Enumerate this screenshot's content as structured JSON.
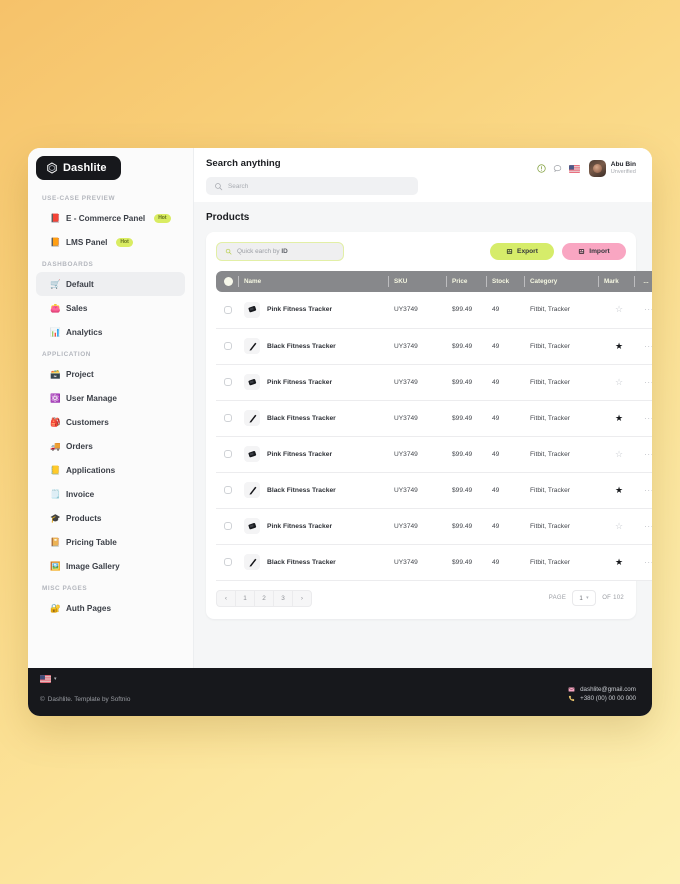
{
  "theme": {
    "bg_gradient_from": "#f6c26a",
    "bg_gradient_to": "#fdf0b4",
    "accent_lime": "#d6ec6a",
    "accent_pink": "#f9a6c2",
    "dark": "#17181c",
    "header_gray": "#87888b"
  },
  "sidebar": {
    "logo": {
      "text": "Dashlite",
      "icon": "hexagon-icon"
    },
    "toggle_icon": "panel-toggle-icon",
    "sections": [
      {
        "label": "USE-CASE PREVIEW",
        "items": [
          {
            "label": "E - Commerce Panel",
            "emoji": "📕",
            "badge": "Hot",
            "active": false
          },
          {
            "label": "LMS Panel",
            "emoji": "📙",
            "badge": "Hot",
            "active": false
          }
        ]
      },
      {
        "label": "DASHBOARDS",
        "items": [
          {
            "label": "Default",
            "emoji": "🛒",
            "badge": "",
            "active": true
          },
          {
            "label": "Sales",
            "emoji": "👛",
            "badge": "",
            "active": false
          },
          {
            "label": "Analytics",
            "emoji": "📊",
            "badge": "",
            "active": false
          }
        ]
      },
      {
        "label": "APPLICATION",
        "items": [
          {
            "label": "Project",
            "emoji": "🗃️",
            "badge": "",
            "active": false
          },
          {
            "label": "User Manage",
            "emoji": "⚛️",
            "badge": "",
            "active": false
          },
          {
            "label": "Customers",
            "emoji": "🎒",
            "badge": "",
            "active": false
          },
          {
            "label": "Orders",
            "emoji": "🚚",
            "badge": "",
            "active": false
          },
          {
            "label": "Applications",
            "emoji": "📒",
            "badge": "",
            "active": false
          },
          {
            "label": "Invoice",
            "emoji": "🗒️",
            "badge": "",
            "active": false
          },
          {
            "label": "Products",
            "emoji": "🎓",
            "badge": "",
            "active": false
          },
          {
            "label": "Pricing Table",
            "emoji": "📔",
            "badge": "",
            "active": false
          },
          {
            "label": "Image Gallery",
            "emoji": "🖼️",
            "badge": "",
            "active": false
          }
        ]
      },
      {
        "label": "MISC PAGES",
        "items": [
          {
            "label": "Auth Pages",
            "emoji": "🔐",
            "badge": "",
            "active": false
          }
        ]
      }
    ]
  },
  "topbar": {
    "search_title": "Search anything",
    "search_placeholder": "Search",
    "search_value": "",
    "icons": [
      "info-icon",
      "chat-icon",
      "flag-icon"
    ],
    "user": {
      "name": "Abu Bin",
      "status": "Unverified",
      "avatar": "avatar"
    }
  },
  "page": {
    "title": "Products"
  },
  "toolbar": {
    "quick_search_placeholder_prefix": "Quick earch by ",
    "quick_search_placeholder_bold": "ID",
    "quick_search_value": "",
    "export_label": "Export",
    "import_label": "Import"
  },
  "table": {
    "columns": [
      "Name",
      "SKU",
      "Price",
      "Stock",
      "Category",
      "Mark",
      "..."
    ],
    "rows": [
      {
        "name": "Pink Fitness Tracker",
        "sku": "UY3749",
        "price": "$99.49",
        "stock": "49",
        "category": "Fitbit, Tracker",
        "marked": false,
        "thumb": "pink",
        "checked": false
      },
      {
        "name": "Black Fitness Tracker",
        "sku": "UY3749",
        "price": "$99.49",
        "stock": "49",
        "category": "Fitbit, Tracker",
        "marked": true,
        "thumb": "black",
        "checked": false
      },
      {
        "name": "Pink Fitness Tracker",
        "sku": "UY3749",
        "price": "$99.49",
        "stock": "49",
        "category": "Fitbit, Tracker",
        "marked": false,
        "thumb": "pink",
        "checked": false
      },
      {
        "name": "Black Fitness Tracker",
        "sku": "UY3749",
        "price": "$99.49",
        "stock": "49",
        "category": "Fitbit, Tracker",
        "marked": true,
        "thumb": "black",
        "checked": false
      },
      {
        "name": "Pink Fitness Tracker",
        "sku": "UY3749",
        "price": "$99.49",
        "stock": "49",
        "category": "Fitbit, Tracker",
        "marked": false,
        "thumb": "pink",
        "checked": false
      },
      {
        "name": "Black Fitness Tracker",
        "sku": "UY3749",
        "price": "$99.49",
        "stock": "49",
        "category": "Fitbit, Tracker",
        "marked": true,
        "thumb": "black",
        "checked": false
      },
      {
        "name": "Pink Fitness Tracker",
        "sku": "UY3749",
        "price": "$99.49",
        "stock": "49",
        "category": "Fitbit, Tracker",
        "marked": false,
        "thumb": "pink",
        "checked": false
      },
      {
        "name": "Black Fitness Tracker",
        "sku": "UY3749",
        "price": "$99.49",
        "stock": "49",
        "category": "Fitbit, Tracker",
        "marked": true,
        "thumb": "black",
        "checked": false
      }
    ]
  },
  "pagination": {
    "prev": "‹",
    "pages": [
      "1",
      "2",
      "3"
    ],
    "next": "›",
    "page_label": "PAGE",
    "current_page": "1",
    "of_label": "OF 102"
  },
  "footer": {
    "language_flag": "us-flag-icon",
    "copyright": "Dashlite. Template by Softnio",
    "email": "dashlite@gmail.com",
    "phone": "+380 (00) 00 00 000"
  }
}
